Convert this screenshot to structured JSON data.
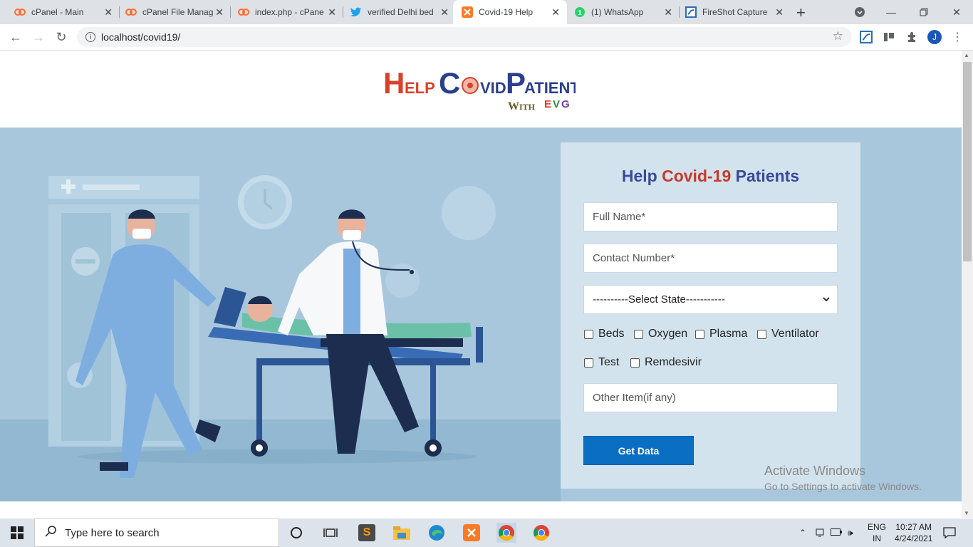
{
  "browser": {
    "tabs": [
      {
        "title": "cPanel - Main",
        "icon": "cpanel-icon"
      },
      {
        "title": "cPanel File Manag",
        "icon": "cpanel-icon"
      },
      {
        "title": "index.php - cPane",
        "icon": "cpanel-icon"
      },
      {
        "title": "verified Delhi bed",
        "icon": "twitter-icon"
      },
      {
        "title": "Covid-19 Help",
        "icon": "xampp-icon",
        "active": true
      },
      {
        "title": "(1) WhatsApp",
        "icon": "whatsapp-icon"
      },
      {
        "title": "FireShot Capture",
        "icon": "fireshot-icon"
      }
    ],
    "new_tab": "+",
    "url": "localhost/covid19/",
    "profile_initial": "J"
  },
  "page": {
    "logo": {
      "line1_help": "HELP",
      "line1_covid": "COVID",
      "line1_patient": "PATIENT",
      "with": "WITH",
      "brand": "EVG"
    },
    "form": {
      "title_prefix": "Help ",
      "title_highlight": "Covid-19",
      "title_suffix": " Patients",
      "full_name_placeholder": "Full Name*",
      "contact_placeholder": "Contact Number*",
      "state_select": "----------Select State-----------",
      "checkboxes": [
        "Beds",
        "Oxygen",
        "Plasma",
        "Ventilator",
        "Test",
        "Remdesivir"
      ],
      "other_placeholder": "Other Item(if any)",
      "submit_label": "Get Data"
    },
    "watermark": {
      "line1": "Activate Windows",
      "line2": "Go to Settings to activate Windows."
    }
  },
  "taskbar": {
    "search_placeholder": "Type here to search",
    "language": "ENG",
    "region": "IN",
    "time": "10:27 AM",
    "date": "4/24/2021"
  },
  "colors": {
    "hero_bg": "#a9c7dc",
    "form_bg": "#d3e3ed",
    "title_blue": "#3a4a9b",
    "title_red": "#c8392b",
    "button_blue": "#0a6fc2"
  }
}
